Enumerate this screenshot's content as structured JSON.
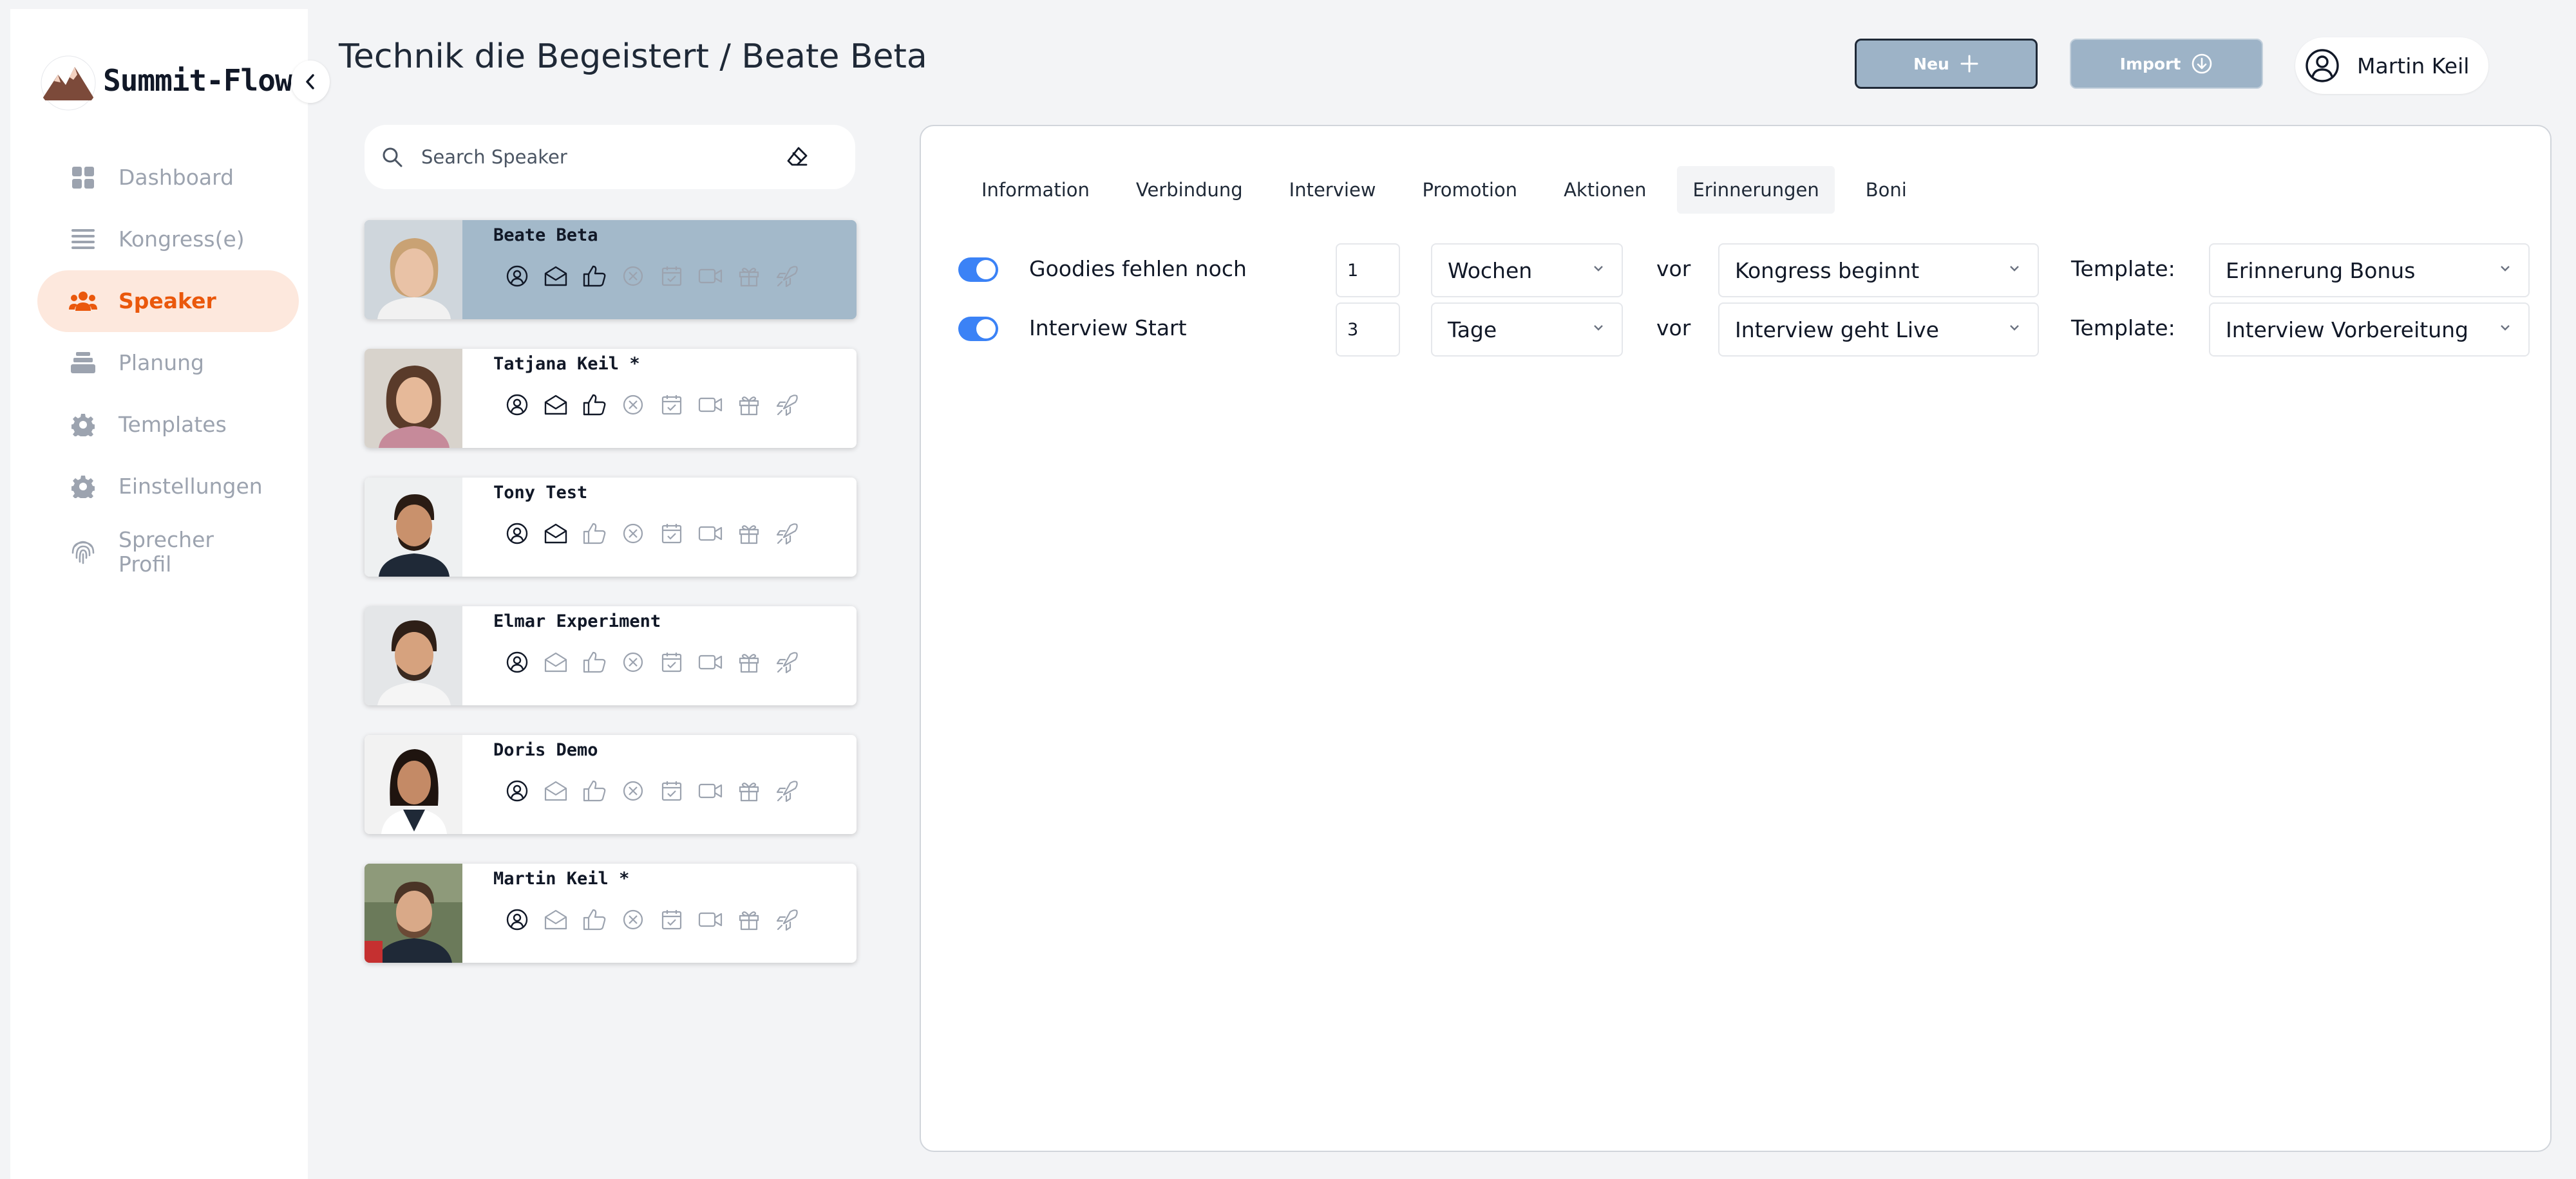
{
  "brand": {
    "name": "Summit-Flow"
  },
  "sidebar": {
    "items": [
      {
        "label": "Dashboard",
        "icon": "grid-icon",
        "active": false
      },
      {
        "label": "Kongress(e)",
        "icon": "list-icon",
        "active": false
      },
      {
        "label": "Speaker",
        "icon": "users-icon",
        "active": true
      },
      {
        "label": "Planung",
        "icon": "stack-icon",
        "active": false
      },
      {
        "label": "Templates",
        "icon": "gear-icon",
        "active": false
      },
      {
        "label": "Einstellungen",
        "icon": "gear-icon",
        "active": false
      },
      {
        "label": "Sprecher Profil",
        "icon": "fingerprint-icon",
        "active": false
      }
    ]
  },
  "header": {
    "title": "Technik die Begeistert / Beate Beta",
    "new_label": "Neu",
    "import_label": "Import",
    "user_name": "Martin Keil"
  },
  "search": {
    "placeholder": "Search Speaker"
  },
  "speakers": [
    {
      "name": "Beate Beta",
      "selected": true
    },
    {
      "name": "Tatjana Keil *",
      "selected": false
    },
    {
      "name": "Tony Test",
      "selected": false
    },
    {
      "name": "Elmar Experiment",
      "selected": false
    },
    {
      "name": "Doris Demo",
      "selected": false
    },
    {
      "name": "Martin Keil *",
      "selected": false
    }
  ],
  "tabs": [
    {
      "label": "Information",
      "active": false
    },
    {
      "label": "Verbindung",
      "active": false
    },
    {
      "label": "Interview",
      "active": false
    },
    {
      "label": "Promotion",
      "active": false
    },
    {
      "label": "Aktionen",
      "active": false
    },
    {
      "label": "Erinnerungen",
      "active": true
    },
    {
      "label": "Boni",
      "active": false
    }
  ],
  "reminders": [
    {
      "enabled": true,
      "name": "Goodies fehlen noch",
      "amount": "1",
      "unit": "Wochen",
      "relation": "vor",
      "event": "Kongress beginnt",
      "template_label": "Template:",
      "template": "Erinnerung Bonus"
    },
    {
      "enabled": true,
      "name": "Interview Start",
      "amount": "3",
      "unit": "Tage",
      "relation": "vor",
      "event": "Interview geht Live",
      "template_label": "Template:",
      "template": "Interview Vorbereitung"
    }
  ],
  "colors": {
    "accent": "#ea580c",
    "active_nav_bg": "#fde8dd",
    "selected_card": "#a3b9ca",
    "toggle_on": "#3b82f6",
    "header_button": "#9db3c7"
  }
}
